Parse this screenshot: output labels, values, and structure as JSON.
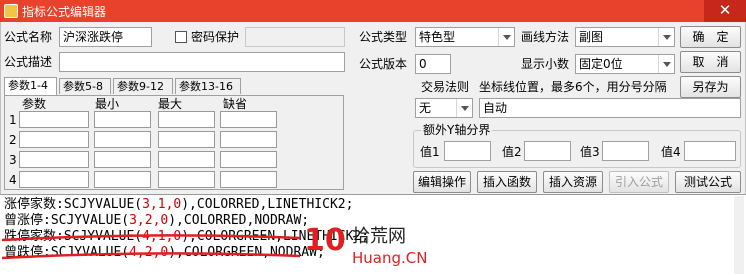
{
  "window": {
    "title": "指标公式编辑器",
    "close_glyph": "✕"
  },
  "form": {
    "name_label": "公式名称",
    "name_value": "沪深涨跌停",
    "password_label": "密码保护",
    "password_value": "",
    "desc_label": "公式描述",
    "desc_value": "",
    "type_label": "公式类型",
    "type_value": "特色型",
    "draw_label": "画线方法",
    "draw_value": "副图",
    "version_label": "公式版本",
    "version_value": "0",
    "decimals_label": "显示小数",
    "decimals_value": "固定0位",
    "trade_rule_label": "交易法则",
    "trade_rule_value": "无",
    "coord_label": "坐标线位置，最多6个，用分号分隔",
    "coord_value": "自动",
    "yaxis_group_label": "额外Y轴分界",
    "yaxis": [
      {
        "label": "值1",
        "value": ""
      },
      {
        "label": "值2",
        "value": ""
      },
      {
        "label": "值3",
        "value": ""
      },
      {
        "label": "值4",
        "value": ""
      }
    ]
  },
  "buttons": {
    "ok": "确　定",
    "cancel": "取　消",
    "save_as": "另存为",
    "edit_op": "编辑操作",
    "insert_func": "插入函数",
    "insert_resource": "插入资源",
    "import_formula": "引入公式",
    "test_formula": "测试公式"
  },
  "params": {
    "tabs": [
      "参数1-4",
      "参数5-8",
      "参数9-12",
      "参数13-16"
    ],
    "headers": [
      "参数",
      "最小",
      "最大",
      "缺省"
    ],
    "rows": [
      "1",
      "2",
      "3",
      "4"
    ]
  },
  "code": {
    "lines": [
      {
        "prefix": "涨停家数:SCJYVALUE(",
        "args": "3,1,0",
        "suffix": "),COLORRED,LINETHICK2;"
      },
      {
        "prefix": "曾涨停:SCJYVALUE(",
        "args": "3,2,0",
        "suffix": "),COLORRED,NODRAW;"
      },
      {
        "prefix": "跌停家数:SCJYVALUE(",
        "args": "4,1,0",
        "suffix": "),COLORGREEN,LINETHICK2;"
      },
      {
        "prefix": "曾跌停:SCJYVALUE(",
        "args": "4,2,0",
        "suffix": "),COLORGREEN,NODRAW;"
      }
    ]
  },
  "watermark": {
    "brand_cn": "拾荒网",
    "brand_en": "Huang.CN",
    "mark": "10"
  },
  "colors": {
    "title_bar": "#e8412c",
    "code_num": "#d00000",
    "watermark_red": "#e02020"
  }
}
